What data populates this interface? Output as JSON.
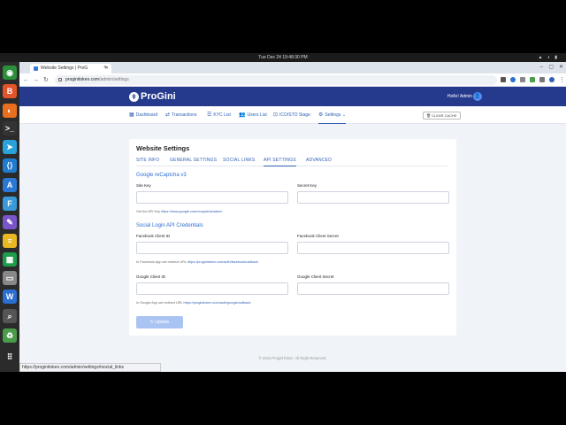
{
  "system": {
    "clock": "Tue Dec 24  19:48:30 PM",
    "tray_icons": [
      "network-icon",
      "volume-icon",
      "battery-icon"
    ]
  },
  "dock": {
    "apps": [
      {
        "name": "chrome",
        "color": "#2c8f3b",
        "glyph": "◉"
      },
      {
        "name": "brave",
        "color": "#e2542b",
        "glyph": "B"
      },
      {
        "name": "firefox",
        "color": "#e86f1f",
        "glyph": "◐"
      },
      {
        "name": "terminal",
        "color": "#333333",
        "glyph": ">_"
      },
      {
        "name": "telegram",
        "color": "#2aa1da",
        "glyph": "➤"
      },
      {
        "name": "vscode",
        "color": "#1f7ccf",
        "glyph": "⟨⟩"
      },
      {
        "name": "app-store",
        "color": "#2a78d4",
        "glyph": "A"
      },
      {
        "name": "flutter",
        "color": "#3a9ad9",
        "glyph": "F"
      },
      {
        "name": "editor",
        "color": "#7a55c9",
        "glyph": "✎"
      },
      {
        "name": "notes",
        "color": "#e9b624",
        "glyph": "≡"
      },
      {
        "name": "spreadsheet",
        "color": "#1f9c4b",
        "glyph": "▦"
      },
      {
        "name": "files",
        "color": "#888888",
        "glyph": "▭"
      },
      {
        "name": "writer",
        "color": "#2a6fd1",
        "glyph": "W"
      },
      {
        "name": "search",
        "color": "#555555",
        "glyph": "⌕"
      },
      {
        "name": "trash",
        "color": "#4a9c4a",
        "glyph": "♻"
      },
      {
        "name": "apps-grid",
        "color": "#2b2b2b",
        "glyph": "⠿"
      }
    ]
  },
  "browser": {
    "tab_title": "Website Settings | ProG",
    "url_host": "proginitoken.com",
    "url_path": "/admin/settings",
    "status_url": "https://proginitoken.com/admin/settings#social_links"
  },
  "header": {
    "brand": "ProGini",
    "greeting": "Hello! Admin"
  },
  "nav": {
    "items": [
      {
        "label": "Dashboard",
        "icon": "▦"
      },
      {
        "label": "Transactions",
        "icon": "⇄"
      },
      {
        "label": "KYC List",
        "icon": "☰"
      },
      {
        "label": "Users List",
        "icon": "👥"
      },
      {
        "label": "ICO/STO Stage",
        "icon": "⊡"
      },
      {
        "label": "Settings",
        "icon": "⚙"
      }
    ],
    "clear_cache": "CLEAR CACHE"
  },
  "settings": {
    "title": "Website Settings",
    "tabs": [
      "SITE INFO",
      "GENERAL SETTINGS",
      "SOCIAL LINKS",
      "API SETTINGS",
      "ADVANCED"
    ],
    "active_tab": "API SETTINGS",
    "recaptcha": {
      "heading": "Google reCaptcha v3",
      "site_key_label": "Site Key",
      "secret_key_label": "Secret Key",
      "site_key_value": "",
      "secret_key_value": "",
      "help_text": "Get the API Key",
      "help_link": "https://www.google.com/recaptcha/admin"
    },
    "social": {
      "heading": "Social Login API Credentials",
      "fb_id_label": "Facebook Client ID",
      "fb_secret_label": "Facebook Client Secret",
      "fb_help": "In Facebook App set redirect URL",
      "fb_link": "https://proginitoken.com/auth/facebook/callback",
      "g_id_label": "Google Client ID",
      "g_secret_label": "Google Client Secret",
      "g_help": "In Google App set redirect URL",
      "g_link": "https://proginitoken.com/auth/google/callback"
    },
    "update_label": "Update"
  },
  "footer": "© 2024 ProginiToken. All Right Reserved.",
  "colors": {
    "header_bg": "#253a8c",
    "accent": "#2f5fb3",
    "button_disabled": "#a9c4f3"
  }
}
